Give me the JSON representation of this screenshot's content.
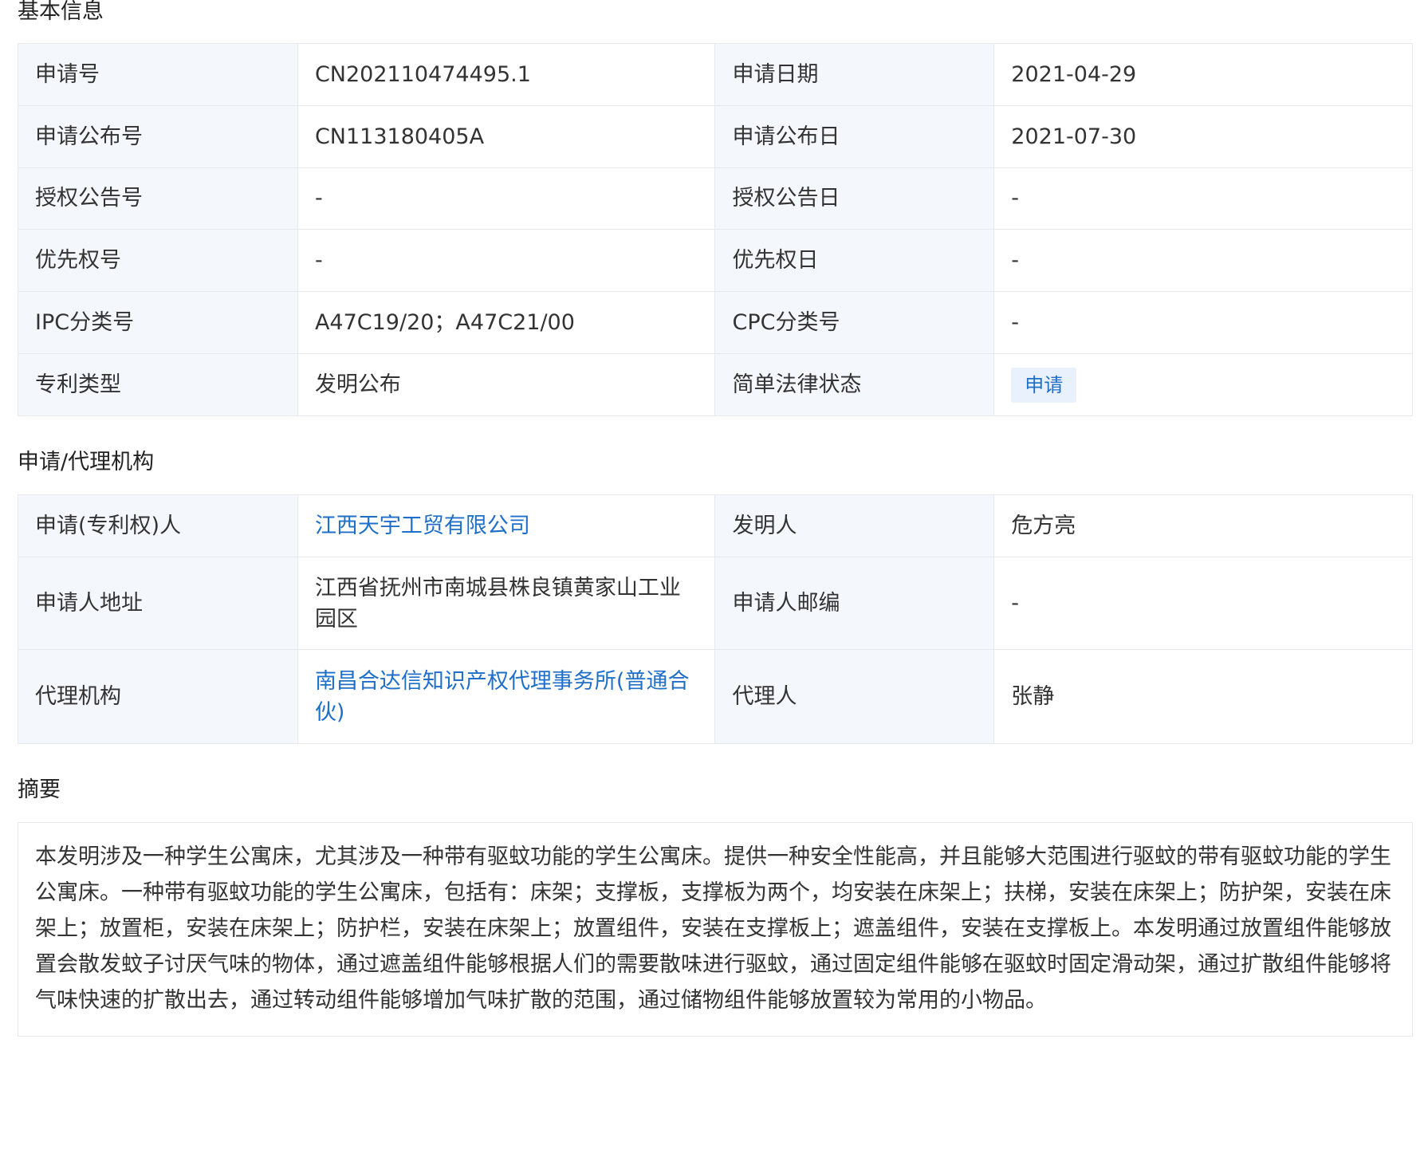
{
  "sections": {
    "basic_title": "基本信息",
    "agency_title": "申请/代理机构",
    "abstract_title": "摘要"
  },
  "basic_info": {
    "rows": [
      {
        "l1": "申请号",
        "v1": "CN202110474495.1",
        "l2": "申请日期",
        "v2": "2021-04-29"
      },
      {
        "l1": "申请公布号",
        "v1": "CN113180405A",
        "l2": "申请公布日",
        "v2": "2021-07-30"
      },
      {
        "l1": "授权公告号",
        "v1": "-",
        "l2": "授权公告日",
        "v2": "-"
      },
      {
        "l1": "优先权号",
        "v1": "-",
        "l2": "优先权日",
        "v2": "-"
      },
      {
        "l1": "IPC分类号",
        "v1": "A47C19/20；A47C21/00",
        "l2": "CPC分类号",
        "v2": "-"
      },
      {
        "l1": "专利类型",
        "v1": "发明公布",
        "l2": "简单法律状态",
        "v2": "申请"
      }
    ]
  },
  "agency_info": {
    "applicant_label": "申请(专利权)人",
    "applicant": "江西天宇工贸有限公司",
    "inventor_label": "发明人",
    "inventor": "危方亮",
    "address_label": "申请人地址",
    "address": "江西省抚州市南城县株良镇黄家山工业园区",
    "postcode_label": "申请人邮编",
    "postcode": "-",
    "agency_label": "代理机构",
    "agency": "南昌合达信知识产权代理事务所(普通合伙)",
    "agent_label": "代理人",
    "agent": "张静"
  },
  "abstract": {
    "text": "本发明涉及一种学生公寓床，尤其涉及一种带有驱蚊功能的学生公寓床。提供一种安全性能高，并且能够大范围进行驱蚊的带有驱蚊功能的学生公寓床。一种带有驱蚊功能的学生公寓床，包括有：床架；支撑板，支撑板为两个，均安装在床架上；扶梯，安装在床架上；防护架，安装在床架上；放置柜，安装在床架上；防护栏，安装在床架上；放置组件，安装在支撑板上；遮盖组件，安装在支撑板上。本发明通过放置组件能够放置会散发蚊子讨厌气味的物体，通过遮盖组件能够根据人们的需要散味进行驱蚊，通过固定组件能够在驱蚊时固定滑动架，通过扩散组件能够将气味快速的扩散出去，通过转动组件能够增加气味扩散的范围，通过储物组件能够放置较为常用的小物品。"
  },
  "colors": {
    "label_bg": "#f4f7fb",
    "border": "#e6eaef",
    "link": "#1f6fc9",
    "tag_bg": "#e9f2fc"
  }
}
